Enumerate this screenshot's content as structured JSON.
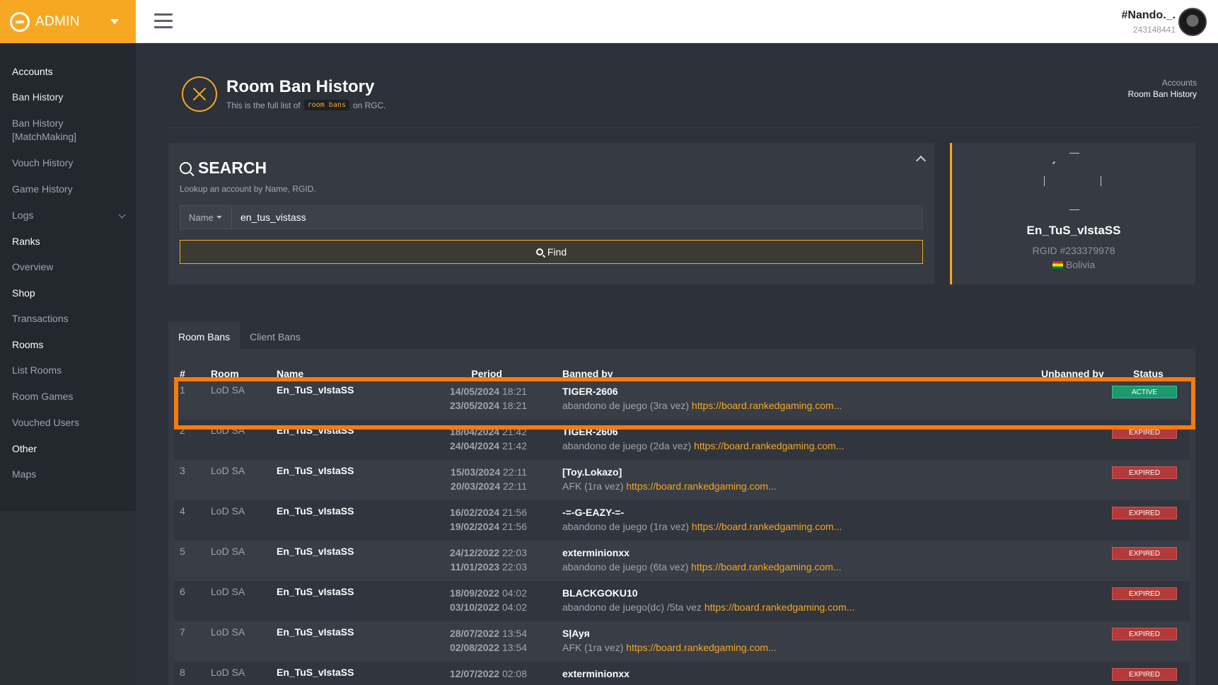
{
  "brand": {
    "title": "ADMIN"
  },
  "user": {
    "name": "#Nando._.",
    "id": "243148441"
  },
  "sidebar": {
    "sections": [
      {
        "head": "Accounts",
        "items": [
          "Ban History",
          "Ban History [MatchMaking]",
          "Vouch History",
          "Game History",
          "Logs"
        ]
      },
      {
        "head": "Ranks",
        "items": [
          "Overview"
        ]
      },
      {
        "head": "Shop",
        "items": [
          "Transactions"
        ]
      },
      {
        "head": "Rooms",
        "items": [
          "List Rooms",
          "Room Games",
          "Vouched Users"
        ]
      },
      {
        "head": "Other",
        "items": [
          "Maps"
        ]
      }
    ]
  },
  "page": {
    "title": "Room Ban History",
    "sub_before": "This is the full list of",
    "sub_code": "room bans",
    "sub_after": "on RGC.",
    "crumb1": "Accounts",
    "crumb2": "Room Ban History"
  },
  "search": {
    "title": "SEARCH",
    "desc": "Lookup an account by Name, RGID.",
    "select": "Name",
    "value": "en_tus_vistass",
    "button": "Find"
  },
  "profile": {
    "name": "En_TuS_vIstaSS",
    "rgid": "RGID #233379978",
    "country": "Bolivia"
  },
  "tabs": [
    "Room Bans",
    "Client Bans"
  ],
  "table": {
    "headers": [
      "#",
      "Room",
      "Name",
      "Period",
      "Banned by",
      "Unbanned by",
      "Status"
    ],
    "rows": [
      {
        "n": "1",
        "room": "LoD SA",
        "name": "En_TuS_vIstaSS",
        "d1": "14/05/2024",
        "t1": "18:21",
        "d2": "23/05/2024",
        "t2": "18:21",
        "by": "TIGER-2606",
        "reason": "abandono de juego (3ra vez)",
        "link": "https://board.rankedgaming.com...",
        "status": "ACTIVE"
      },
      {
        "n": "2",
        "room": "LoD SA",
        "name": "En_TuS_vIstaSS",
        "d1": "18/04/2024",
        "t1": "21:42",
        "d2": "24/04/2024",
        "t2": "21:42",
        "by": "TIGER-2606",
        "reason": "abandono de juego (2da vez)",
        "link": "https://board.rankedgaming.com...",
        "status": "EXPIRED"
      },
      {
        "n": "3",
        "room": "LoD SA",
        "name": "En_TuS_vIstaSS",
        "d1": "15/03/2024",
        "t1": "22:11",
        "d2": "20/03/2024",
        "t2": "22:11",
        "by": "[Toy.Lokazo]",
        "reason": "AFK (1ra vez)",
        "link": "https://board.rankedgaming.com...",
        "status": "EXPIRED"
      },
      {
        "n": "4",
        "room": "LoD SA",
        "name": "En_TuS_vIstaSS",
        "d1": "16/02/2024",
        "t1": "21:56",
        "d2": "19/02/2024",
        "t2": "21:56",
        "by": "-=-G-EAZY-=-",
        "reason": "abandono de juego (1ra vez)",
        "link": "https://board.rankedgaming.com...",
        "status": "EXPIRED"
      },
      {
        "n": "5",
        "room": "LoD SA",
        "name": "En_TuS_vIstaSS",
        "d1": "24/12/2022",
        "t1": "22:03",
        "d2": "11/01/2023",
        "t2": "22:03",
        "by": "exterminionxx",
        "reason": "abandono de juego (6ta vez)",
        "link": "https://board.rankedgaming.com...",
        "status": "EXPIRED"
      },
      {
        "n": "6",
        "room": "LoD SA",
        "name": "En_TuS_vIstaSS",
        "d1": "18/09/2022",
        "t1": "04:02",
        "d2": "03/10/2022",
        "t2": "04:02",
        "by": "BLACKGOKU10",
        "reason": "abandono de juego(dc) /5ta vez",
        "link": "https://board.rankedgaming.com...",
        "status": "EXPIRED"
      },
      {
        "n": "7",
        "room": "LoD SA",
        "name": "En_TuS_vIstaSS",
        "d1": "28/07/2022",
        "t1": "13:54",
        "d2": "02/08/2022",
        "t2": "13:54",
        "by": "SļAyᴙ",
        "reason": "AFK (1ra vez)",
        "link": "https://board.rankedgaming.com...",
        "status": "EXPIRED"
      },
      {
        "n": "8",
        "room": "LoD SA",
        "name": "En_TuS_vIstaSS",
        "d1": "12/07/2022",
        "t1": "02:08",
        "d2": "",
        "t2": "",
        "by": "exterminionxx",
        "reason": "",
        "link": "",
        "status": "EXPIRED"
      }
    ]
  }
}
